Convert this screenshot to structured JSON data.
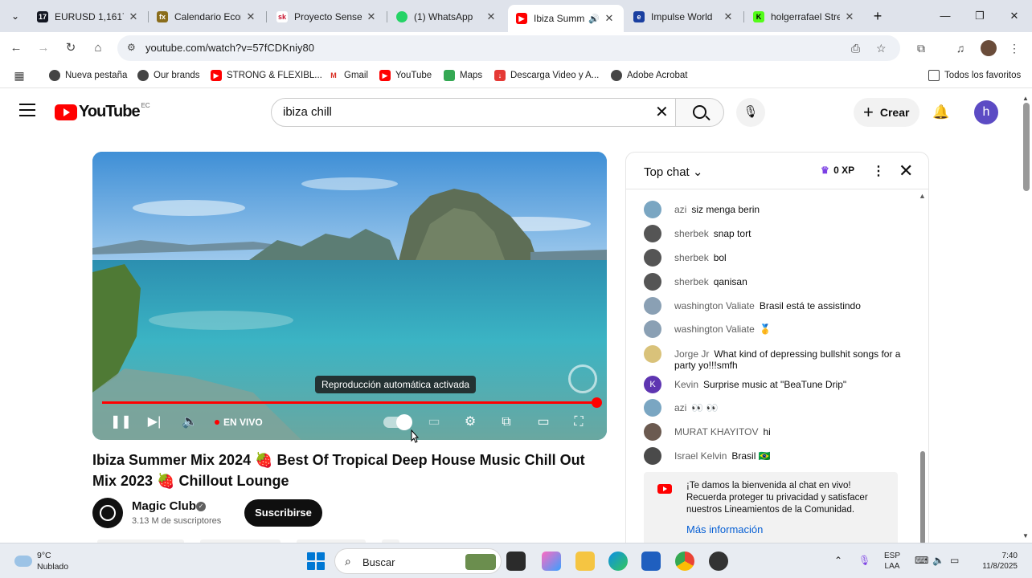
{
  "browser": {
    "tabs": [
      {
        "label": "EURUSD 1,1617",
        "favicon": "tradingview-icon",
        "color": "#131722"
      },
      {
        "label": "Calendario Econ",
        "favicon": "fx-icon",
        "color": "#8a6d1b"
      },
      {
        "label": "Proyecto Sensei",
        "favicon": "sk-icon",
        "color": "#c8102e"
      },
      {
        "label": "(1) WhatsApp",
        "favicon": "whatsapp-icon",
        "color": "#25d366"
      },
      {
        "label": "Ibiza Summ",
        "favicon": "youtube-icon",
        "color": "#ff0000",
        "active": true
      },
      {
        "label": "Impulse World",
        "favicon": "impulse-icon",
        "color": "#1a3fa0"
      },
      {
        "label": "holgerrafael Stre",
        "favicon": "kick-icon",
        "color": "#53fc18"
      }
    ],
    "url": "youtube.com/watch?v=57fCDKniy80",
    "bookmarks": [
      {
        "label": "Nueva pestaña",
        "icon": "globe-icon"
      },
      {
        "label": "Our brands",
        "icon": "globe-icon"
      },
      {
        "label": "STRONG & FLEXIBL...",
        "icon": "youtube-icon"
      },
      {
        "label": "Gmail",
        "icon": "gmail-icon"
      },
      {
        "label": "YouTube",
        "icon": "youtube-icon"
      },
      {
        "label": "Maps",
        "icon": "maps-icon"
      },
      {
        "label": "Descarga Video y A...",
        "icon": "download-icon"
      },
      {
        "label": "Adobe Acrobat",
        "icon": "globe-icon"
      }
    ],
    "all_bookmarks": "Todos los favoritos"
  },
  "youtube": {
    "wordmark": "YouTube",
    "region": "EC",
    "search_value": "ibiza chill",
    "create_label": "Crear",
    "avatar_letter": "h",
    "player": {
      "tooltip": "Reproducción automática activada",
      "live_label": "EN VIVO",
      "progress": 1.0
    },
    "video": {
      "title_part1": "Ibiza Summer Mix 2024",
      "title_part2": "Best Of Tropical Deep House Music Chill Out Mix 2023",
      "title_part3": "Chillout Lounge",
      "strawberry": "🍓",
      "channel": "Magic Club",
      "subscribers": "3.13 M de suscriptores",
      "subscribe_label": "Suscribirse"
    },
    "chat": {
      "header": "Top chat",
      "xp": "0 XP",
      "messages": [
        {
          "author": "azi",
          "text": "siz menga berin",
          "color": "#7aa6c2"
        },
        {
          "author": "sherbek",
          "text": "snap tort",
          "color": "#555"
        },
        {
          "author": "sherbek",
          "text": "bol",
          "color": "#555"
        },
        {
          "author": "sherbek",
          "text": "qanisan",
          "color": "#555"
        },
        {
          "author": "washington Valiate",
          "text": "Brasil está te assistindo",
          "color": "#8aa0b4"
        },
        {
          "author": "washington Valiate",
          "text": "🥇",
          "color": "#8aa0b4"
        },
        {
          "author": "Jorge Jr",
          "text": "What kind of depressing bullshit songs for a party yo!!!smfh",
          "color": "#d9c27a"
        },
        {
          "author": "Kevin",
          "text": "Surprise music at \"BeaTune Drip\"",
          "color": "#5e35b1",
          "letter": "K"
        },
        {
          "author": "azi",
          "text": "👀 👀",
          "color": "#7aa6c2"
        },
        {
          "author": "MURAT KHAYITOV",
          "text": "hi",
          "color": "#6b5a50"
        },
        {
          "author": "Israel Kelvin",
          "text": "Brasil 🇧🇷",
          "color": "#4a4a4a"
        }
      ],
      "welcome_text": "¡Te damos la bienvenida al chat en vivo! Recuerda proteger tu privacidad y satisfacer nuestros Lineamientos de la Comunidad.",
      "welcome_link": "Más información"
    }
  },
  "taskbar": {
    "temp": "9°C",
    "weather": "Nublado",
    "search_placeholder": "Buscar",
    "lang_top": "ESP",
    "lang_bottom": "LAA",
    "time": "7:40",
    "date": "11/8/2025"
  }
}
